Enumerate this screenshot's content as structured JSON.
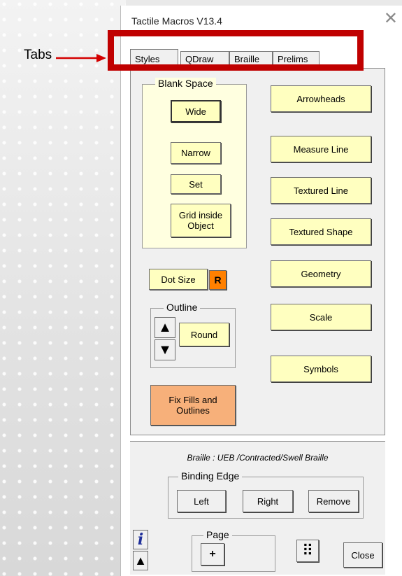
{
  "annotation": {
    "label": "Tabs"
  },
  "window": {
    "title": "Tactile Macros V13.4",
    "close_glyph": "✕"
  },
  "tabs": [
    {
      "label": "Styles",
      "active": true
    },
    {
      "label": "QDraw",
      "active": false
    },
    {
      "label": "Braille",
      "active": false
    },
    {
      "label": "Prelims",
      "active": false
    }
  ],
  "blank_space": {
    "legend": "Blank Space",
    "wide": "Wide",
    "narrow": "Narrow",
    "set": "Set",
    "grid_line1": "Grid inside",
    "grid_line2": "Object"
  },
  "right_buttons": {
    "arrowheads": "Arrowheads",
    "measure_line": "Measure Line",
    "textured_line": "Textured Line",
    "textured_shape": "Textured Shape",
    "geometry": "Geometry",
    "scale": "Scale",
    "symbols": "Symbols"
  },
  "dot_size": {
    "label": "Dot Size",
    "badge": "R"
  },
  "outline": {
    "legend": "Outline",
    "round": "Round",
    "up_glyph": "▲",
    "down_glyph": "▼"
  },
  "fix_fills": {
    "line1": "Fix Fills and",
    "line2": "Outlines"
  },
  "bottom": {
    "status": "Braille : UEB /Contracted/Swell Braille",
    "binding_edge": {
      "legend": "Binding Edge",
      "left": "Left",
      "right": "Right",
      "remove": "Remove"
    },
    "page": {
      "legend": "Page",
      "plus": "+"
    },
    "info_glyph": "i",
    "up_glyph": "▲",
    "braille_glyph": "⠿",
    "close": "Close"
  },
  "colors": {
    "button_yellow": "#ffffc0",
    "fix_orange": "#f7b07a",
    "badge_orange": "#ff8000",
    "highlight_red": "#c00000",
    "info_blue": "#1f2f9a"
  }
}
